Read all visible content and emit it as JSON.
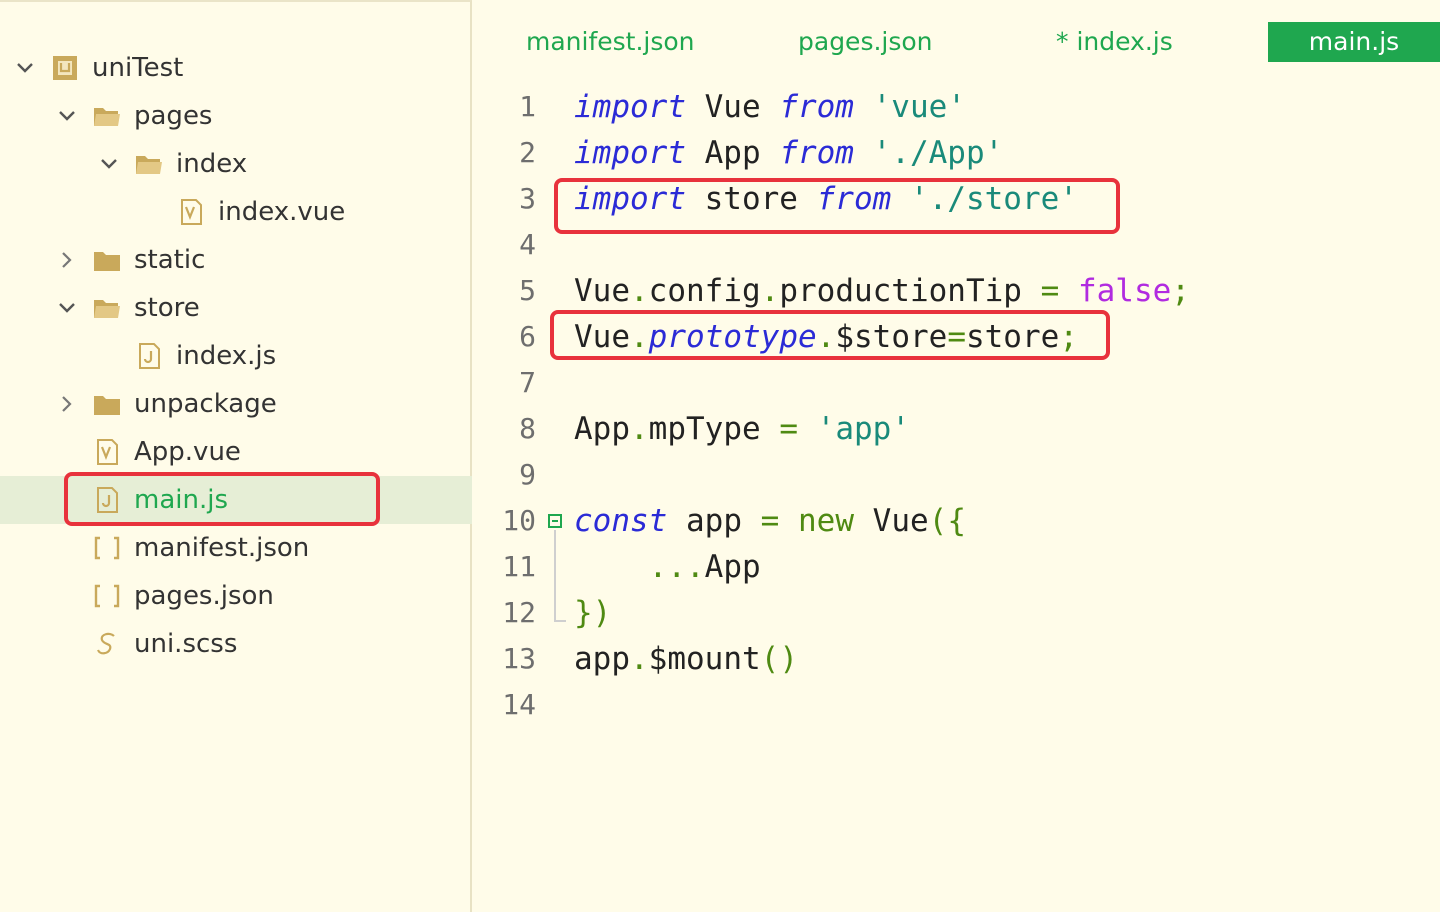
{
  "sidebar": {
    "tree": [
      {
        "label": "uniTest",
        "chevron": "down",
        "icon": "project-icon",
        "depth": 0
      },
      {
        "label": "pages",
        "chevron": "down",
        "icon": "folder-open-icon",
        "depth": 1
      },
      {
        "label": "index",
        "chevron": "down",
        "icon": "folder-open-icon",
        "depth": 2
      },
      {
        "label": "index.vue",
        "chevron": "",
        "icon": "vue-file-icon",
        "depth": 3
      },
      {
        "label": "static",
        "chevron": "right",
        "icon": "folder-icon",
        "depth": 1
      },
      {
        "label": "store",
        "chevron": "down",
        "icon": "folder-open-icon",
        "depth": 1
      },
      {
        "label": "index.js",
        "chevron": "",
        "icon": "js-file-icon",
        "depth": 2
      },
      {
        "label": "unpackage",
        "chevron": "right",
        "icon": "folder-icon",
        "depth": 1
      },
      {
        "label": "App.vue",
        "chevron": "",
        "icon": "vue-file-icon",
        "depth": 1
      },
      {
        "label": "main.js",
        "chevron": "",
        "icon": "js-file-icon",
        "depth": 1,
        "selected": true
      },
      {
        "label": "manifest.json",
        "chevron": "",
        "icon": "json-file-icon",
        "depth": 1
      },
      {
        "label": "pages.json",
        "chevron": "",
        "icon": "json-file-icon",
        "depth": 1
      },
      {
        "label": "uni.scss",
        "chevron": "",
        "icon": "scss-file-icon",
        "depth": 1
      }
    ]
  },
  "tabs": [
    {
      "label": "manifest.json",
      "active": false
    },
    {
      "label": "pages.json",
      "active": false
    },
    {
      "label": "* index.js",
      "active": false
    },
    {
      "label": "main.js",
      "active": true
    }
  ],
  "editor": {
    "line_numbers": [
      "1",
      "2",
      "3",
      "4",
      "5",
      "6",
      "7",
      "8",
      "9",
      "10",
      "11",
      "12",
      "13",
      "14"
    ],
    "lines": [
      [
        {
          "t": "import",
          "c": "kw"
        },
        {
          "t": " Vue ",
          "c": "id"
        },
        {
          "t": "from",
          "c": "kw"
        },
        {
          "t": " ",
          "c": "id"
        },
        {
          "t": "'vue'",
          "c": "str"
        }
      ],
      [
        {
          "t": "import",
          "c": "kw"
        },
        {
          "t": " App ",
          "c": "id"
        },
        {
          "t": "from",
          "c": "kw"
        },
        {
          "t": " ",
          "c": "id"
        },
        {
          "t": "'./App'",
          "c": "str"
        }
      ],
      [
        {
          "t": "import",
          "c": "kw"
        },
        {
          "t": " store ",
          "c": "id"
        },
        {
          "t": "from",
          "c": "kw"
        },
        {
          "t": " ",
          "c": "id"
        },
        {
          "t": "'./store'",
          "c": "str"
        }
      ],
      [],
      [
        {
          "t": "Vue",
          "c": "id"
        },
        {
          "t": ".",
          "c": "pun"
        },
        {
          "t": "config",
          "c": "id"
        },
        {
          "t": ".",
          "c": "pun"
        },
        {
          "t": "productionTip ",
          "c": "id"
        },
        {
          "t": "=",
          "c": "pun"
        },
        {
          "t": " ",
          "c": "id"
        },
        {
          "t": "false",
          "c": "bool"
        },
        {
          "t": ";",
          "c": "pun"
        }
      ],
      [
        {
          "t": "Vue",
          "c": "id"
        },
        {
          "t": ".",
          "c": "pun"
        },
        {
          "t": "prototype",
          "c": "prop"
        },
        {
          "t": ".",
          "c": "pun"
        },
        {
          "t": "$store",
          "c": "id"
        },
        {
          "t": "=",
          "c": "pun"
        },
        {
          "t": "store",
          "c": "id"
        },
        {
          "t": ";",
          "c": "pun"
        }
      ],
      [],
      [
        {
          "t": "App",
          "c": "id"
        },
        {
          "t": ".",
          "c": "pun"
        },
        {
          "t": "mpType ",
          "c": "id"
        },
        {
          "t": "=",
          "c": "pun"
        },
        {
          "t": " ",
          "c": "id"
        },
        {
          "t": "'app'",
          "c": "str"
        }
      ],
      [],
      [
        {
          "t": "const",
          "c": "kw"
        },
        {
          "t": " app ",
          "c": "id"
        },
        {
          "t": "=",
          "c": "pun"
        },
        {
          "t": " ",
          "c": "id"
        },
        {
          "t": "new",
          "c": "pun"
        },
        {
          "t": " Vue",
          "c": "id"
        },
        {
          "t": "({",
          "c": "pun"
        }
      ],
      [
        {
          "t": "    ",
          "c": "id"
        },
        {
          "t": "...",
          "c": "pun"
        },
        {
          "t": "App",
          "c": "id"
        }
      ],
      [
        {
          "t": "})",
          "c": "pun"
        }
      ],
      [
        {
          "t": "app",
          "c": "id"
        },
        {
          "t": ".",
          "c": "pun"
        },
        {
          "t": "$mount",
          "c": "id"
        },
        {
          "t": "()",
          "c": "pun"
        }
      ],
      []
    ]
  },
  "colors": {
    "background": "#FFFCE9",
    "accent": "#1FA74F",
    "highlight_box": "#E8323C",
    "keyword": "#2B2BD6",
    "string": "#1A8A7A",
    "boolean": "#B12BE0"
  }
}
